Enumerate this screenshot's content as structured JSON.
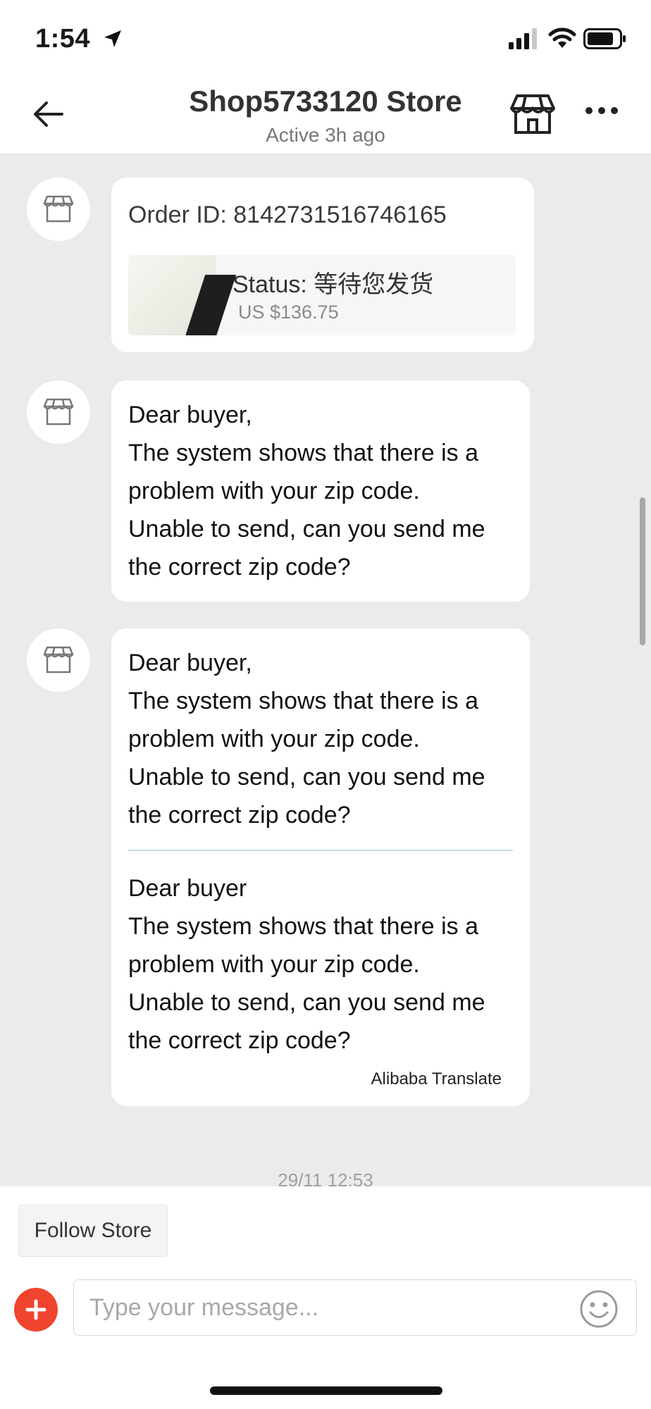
{
  "status_bar": {
    "time": "1:54",
    "icons": [
      "location-arrow-icon",
      "signal-icon",
      "wifi-icon",
      "battery-icon"
    ]
  },
  "header": {
    "title": "Shop5733120 Store",
    "subtitle": "Active 3h ago",
    "icons": [
      "back-arrow-icon",
      "store-icon",
      "more-icon"
    ]
  },
  "messages": {
    "order": {
      "order_id": "Order ID: 8142731516746165",
      "status": "Status:  等待您发货",
      "price": "US $136.75"
    },
    "msg1": {
      "text": "Dear buyer,\nThe system shows that there is a\nproblem with your zip code.\nUnable to send, can you send me\nthe correct zip code?"
    },
    "msg2": {
      "original": "Dear buyer,\nThe system shows that there is a\nproblem with your zip code.\nUnable to send, can you send me\nthe correct zip code?",
      "translated": "Dear buyer\nThe system shows that there is a\nproblem with your zip code.\nUnable to send, can you send me\nthe correct zip code?",
      "translate_label": "Alibaba Translate"
    },
    "timestamp": "29/11 12:53"
  },
  "footer": {
    "follow_label": "Follow Store",
    "input_placeholder": "Type your message..."
  },
  "colors": {
    "accent": "#f0442f",
    "chat_background": "#ebebeb",
    "bubble": "#ffffff"
  }
}
